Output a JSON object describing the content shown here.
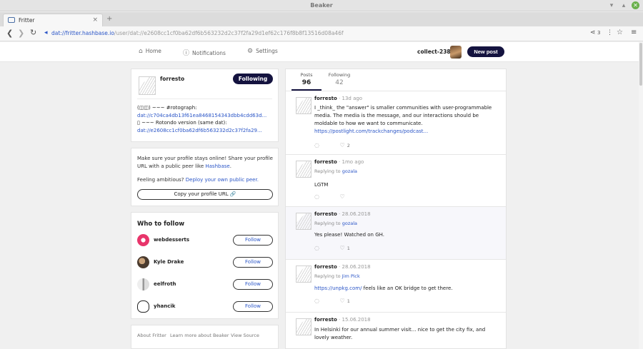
{
  "window": {
    "title": "Beaker"
  },
  "tab": {
    "label": "Fritter",
    "close": "×",
    "new_tab": "+"
  },
  "address": {
    "scheme": "dat://",
    "host": "fritter.hashbase.io",
    "path": "/user/dat://e2608cc1cf0ba62df6b563232d2c37f2fa29d1ef62c176f8b8f13516d08a46f",
    "peers": "3"
  },
  "nav": {
    "home": "Home",
    "notifications": "Notifications",
    "settings": "Settings",
    "username": "collect-238",
    "new_post": "New post"
  },
  "profile": {
    "name": "forresto",
    "following_label": "Following",
    "bio_lines": [
      "(◫◫) ~~~ #rotograph:",
      "dat://c704ca4db13f61ea8468154343dbb4cdd63d...",
      "▯ ~~~ Rotondo version (same dat):",
      "dat://e2608cc1cf0ba62df6b563232d2c37f2fa29..."
    ]
  },
  "share": {
    "text_a": "Make sure your profile stays online! Share your profile URL with a public peer like ",
    "text_link": "Hashbase",
    "text_b": ".",
    "ambitious": "Feeling ambitious? ",
    "ambitious_link": "Deploy your own public peer.",
    "copy_button": "Copy your profile URL 🔗"
  },
  "who_to_follow": {
    "title": "Who to follow",
    "users": [
      {
        "name": "webdesserts",
        "button": "Follow"
      },
      {
        "name": "Kyle Drake",
        "button": "Follow"
      },
      {
        "name": "eelfroth",
        "button": "Follow"
      },
      {
        "name": "yhancik",
        "button": "Follow"
      }
    ]
  },
  "footer": {
    "about": "About Fritter",
    "learn": "Learn more about Beaker",
    "source": "View Source"
  },
  "feed": {
    "tabs": [
      {
        "label": "Posts",
        "count": "96"
      },
      {
        "label": "Following",
        "count": "42"
      }
    ],
    "posts": [
      {
        "author": "forresto",
        "time": " · 13d ago",
        "reply_prefix": "",
        "reply_to": "",
        "text": "I _think_ the \"answer\" is smaller communities with user-programmable media. The media is the message, and our interactions should be moldable to how we want to communicate.",
        "link": "https://postlight.com/trackchanges/podcast...",
        "likes": "2"
      },
      {
        "author": "forresto",
        "time": " · 1mo ago",
        "reply_prefix": "Replying to ",
        "reply_to": "gozala",
        "text": "LGTM",
        "link": "",
        "likes": ""
      },
      {
        "author": "forresto",
        "time": " · 28.06.2018",
        "reply_prefix": "Replying to ",
        "reply_to": "gozala",
        "text": "Yes please! Watched on GH.",
        "link": "",
        "likes": "1"
      },
      {
        "author": "forresto",
        "time": " · 28.06.2018",
        "reply_prefix": "Replying to ",
        "reply_to": "Jim Pick",
        "text": " feels like an OK bridge to get there.",
        "link": "https://unpkg.com/",
        "likes": "1"
      },
      {
        "author": "forresto",
        "time": " · 15.06.2018",
        "reply_prefix": "",
        "reply_to": "",
        "text": "In Helsinki for our annual summer visit... nice to get the city fix, and lovely weather.",
        "link": "",
        "likes": ""
      }
    ]
  },
  "colors": {
    "accent": "#14133f",
    "link": "#2a55c7"
  }
}
